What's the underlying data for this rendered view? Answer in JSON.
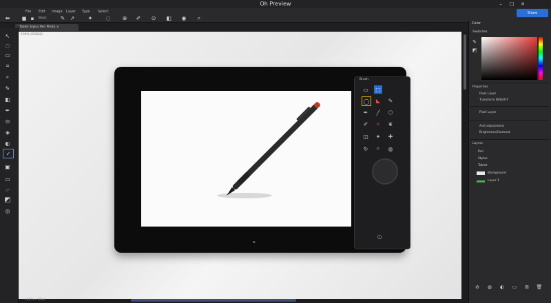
{
  "window": {
    "title": "Oh Preview"
  },
  "menu": {
    "items": [
      "File",
      "Edit",
      "Image",
      "Layer",
      "Type",
      "Select"
    ]
  },
  "options": {
    "mode_label": "Basic",
    "share_label": "Share"
  },
  "tab": {
    "label": "Tablet Stylus Pen  Photo  ×"
  },
  "canvas": {
    "label": "100% (RGB/8)",
    "bottom_label": "100%  •  1Doc"
  },
  "tablet_panel": {
    "title": "Brush"
  },
  "right_panel": {
    "tab_label": "Color",
    "color_title": "Swatches",
    "sections": [
      "Properties",
      "Pixel Layer",
      "Transform",
      "Adjustments",
      "Layers"
    ],
    "properties_items": [
      "Pixel Layer",
      "Transform W/H/X/Y"
    ],
    "adjust_items": [
      "Add adjustment",
      "Brightness/Contrast"
    ],
    "layers_items": [
      "Pen",
      "Stylus",
      "Tablet",
      "Background",
      "Layer 1"
    ]
  },
  "colors": {
    "accent": "#2b6fd6",
    "panel_bg": "#2a2a2c",
    "canvas_bg": "#ececec",
    "tablet": "#0c0c0c"
  }
}
